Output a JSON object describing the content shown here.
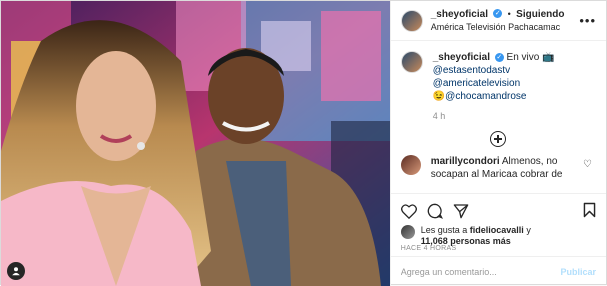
{
  "post": {
    "username": "_sheyoficial",
    "verified_mark": "✓",
    "separator": "•",
    "follow_status": "Siguiendo",
    "location": "América Televisión Pachacamac"
  },
  "caption": {
    "username": "_sheyoficial",
    "text_live": "En vivo",
    "live_emoji": "📺",
    "mention1": "@estasentodastv",
    "mention2": "@americatelevision",
    "emoji": "😉",
    "mention3": "@chocamandrose",
    "time": "4 h"
  },
  "comment": {
    "username": "marillycondori",
    "text": "Almenos, no socapan al Maricaa cobrar de"
  },
  "likes": {
    "prefix": "Les gusta a",
    "user": "fideliocavalli",
    "connector": "y",
    "count": "11,068 personas más"
  },
  "timestamp": "HACE 4 HORAS",
  "add_comment": {
    "placeholder": "Agrega un comentario...",
    "publish": "Publicar"
  },
  "icons": {
    "more": "more-options-icon",
    "tag": "user-tag-icon",
    "like": "heart-icon",
    "comment": "comment-icon",
    "share": "share-icon",
    "save": "bookmark-icon",
    "load_more": "plus-circle-icon"
  }
}
